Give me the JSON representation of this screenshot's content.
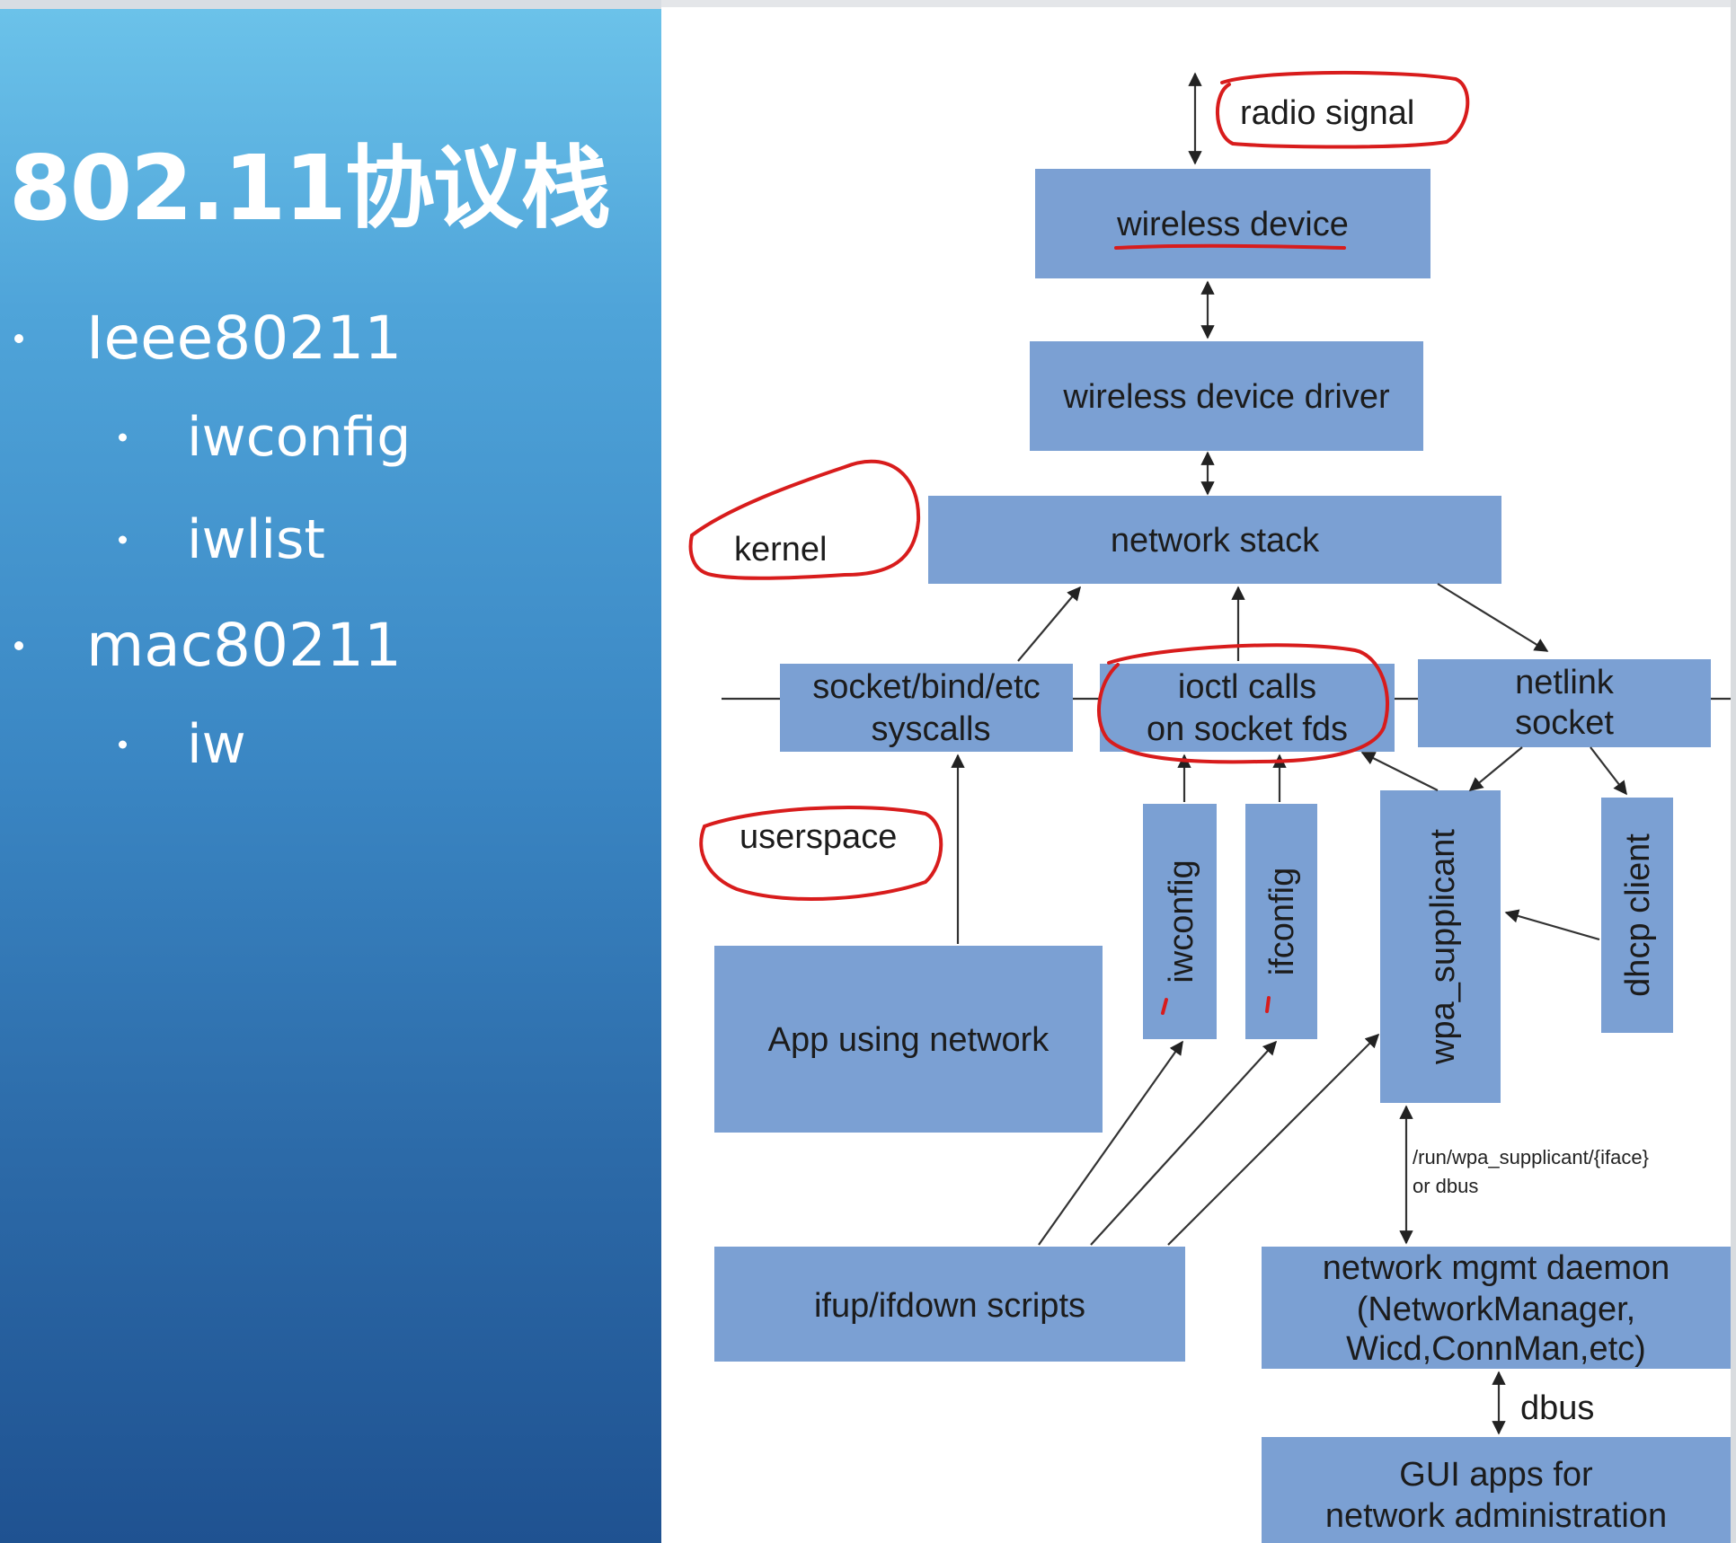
{
  "slide": {
    "title": "802.11协议栈",
    "bullets": [
      {
        "level": 1,
        "text": "Ieee80211"
      },
      {
        "level": 2,
        "text": "iwconfig"
      },
      {
        "level": 2,
        "text": "iwlist"
      },
      {
        "level": 1,
        "text": "mac80211"
      },
      {
        "level": 2,
        "text": "iw"
      }
    ]
  },
  "diagram": {
    "labels": {
      "radio_signal": "radio signal",
      "kernel": "kernel",
      "userspace": "userspace",
      "path_note_1": "/run/wpa_supplicant/{iface}",
      "path_note_2": "or dbus",
      "dbus": "dbus"
    },
    "boxes": {
      "wireless_device": "wireless device",
      "wireless_device_driver": "wireless device driver",
      "network_stack": "network stack",
      "socket_syscalls_1": "socket/bind/etc",
      "socket_syscalls_2": "syscalls",
      "ioctl_1": "ioctl calls",
      "ioctl_2": "on socket fds",
      "netlink_1": "netlink",
      "netlink_2": "socket",
      "iwconfig": "iwconfig",
      "ifconfig": "ifconfig",
      "wpa_supplicant": "wpa_supplicant",
      "dhcp_client": "dhcp client",
      "app_using_network": "App using network",
      "ifup_ifdown": "ifup/ifdown scripts",
      "mgmt_daemon_1": "network mgmt daemon",
      "mgmt_daemon_2": "(NetworkManager,",
      "mgmt_daemon_3": "Wicd,ConnMan,etc)",
      "gui_apps_1": "GUI apps for",
      "gui_apps_2": "network administration"
    }
  }
}
